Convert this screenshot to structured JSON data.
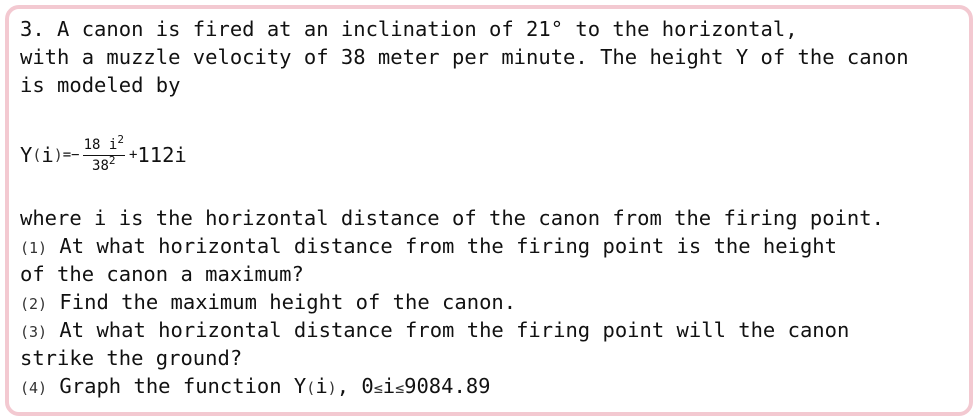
{
  "problem": {
    "intro_line1": "3. A canon is fired at an inclination of 21° to the horizontal,",
    "intro_line2": "with a muzzle velocity of 38 meter per minute. The height Y of the canon",
    "intro_line3": "is modeled by",
    "equation": {
      "lhs_name": "Y",
      "lhs_open": "(",
      "lhs_var": "i",
      "lhs_close": ")",
      "equals_minus": "=−",
      "numerator_coef": "18 i",
      "numerator_exp": "2",
      "denominator_base": "38",
      "denominator_exp": "2",
      "plus": "+",
      "linear_term": "112i"
    },
    "where_line": "where i is the horizontal distance of the canon from the firing point.",
    "questions": [
      {
        "marker": "(1)",
        "line1": " At what horizontal distance from the firing point is the height",
        "line2": "of the canon a maximum?"
      },
      {
        "marker": "(2)",
        "line1": " Find the maximum height of the canon."
      },
      {
        "marker": "(3)",
        "line1": " At what horizontal distance from the firing point will the canon",
        "line2": "strike the ground?"
      },
      {
        "marker": "(4)",
        "line1": " Graph the function Y",
        "fn_open": "(",
        "fn_var": "i",
        "fn_close": ")",
        "domain_prefix": ", 0",
        "leq1": "≤",
        "domain_var": "i",
        "leq2": "≤",
        "domain_max": "9084.89"
      }
    ]
  }
}
